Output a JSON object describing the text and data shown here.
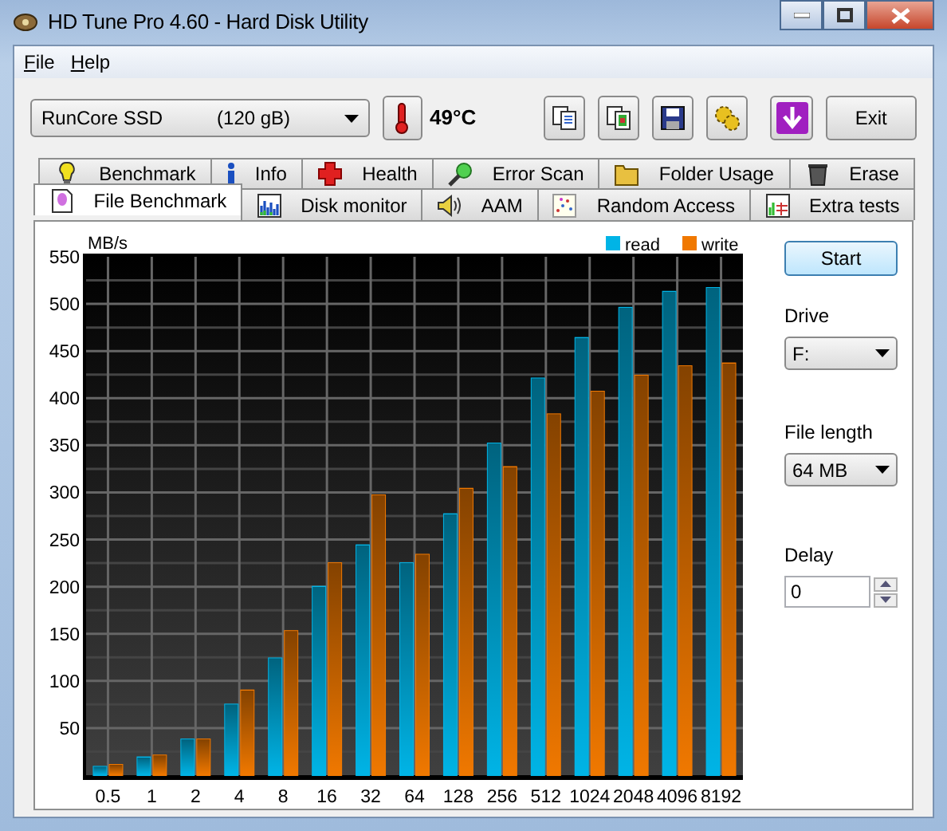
{
  "window": {
    "title": "HD Tune Pro 4.60 - Hard Disk Utility"
  },
  "menu": [
    "File",
    "Help"
  ],
  "toolbar": {
    "drive": {
      "name": "RunCore SSD",
      "size": "(120 gB)"
    },
    "temperature": "49°C",
    "icon_buttons": [
      {
        "kind": "copy"
      },
      {
        "kind": "copy-all"
      },
      {
        "kind": "save"
      },
      {
        "kind": "options"
      },
      {
        "kind": "download"
      }
    ],
    "exit": "Exit"
  },
  "tabs_row1": [
    {
      "label": "Benchmark",
      "kind": "bulb",
      "selected": false
    },
    {
      "label": "Info",
      "kind": "info",
      "selected": false
    },
    {
      "label": "Health",
      "kind": "cross",
      "selected": false
    },
    {
      "label": "Error Scan",
      "kind": "magnifier",
      "selected": false
    },
    {
      "label": "Folder Usage",
      "kind": "folder",
      "selected": false
    },
    {
      "label": "Erase",
      "kind": "trash",
      "selected": false
    }
  ],
  "tabs_row2": [
    {
      "label": "File Benchmark",
      "kind": "file",
      "selected": true
    },
    {
      "label": "Disk monitor",
      "kind": "bars",
      "selected": false
    },
    {
      "label": "AAM",
      "kind": "speaker",
      "selected": false
    },
    {
      "label": "Random Access",
      "kind": "dots",
      "selected": false
    },
    {
      "label": "Extra tests",
      "kind": "grid",
      "selected": false
    }
  ],
  "benchmark": {
    "chart_data": {
      "type": "bar",
      "ylabel": "MB/s",
      "categories": [
        "0.5",
        "1",
        "2",
        "4",
        "8",
        "16",
        "32",
        "64",
        "128",
        "256",
        "512",
        "1024",
        "2048",
        "4096",
        "8192"
      ],
      "series": [
        {
          "name": "read",
          "color": "#00b4e6",
          "values": [
            9,
            19,
            38,
            75,
            124,
            200,
            244,
            225,
            277,
            352,
            421,
            464,
            496,
            513,
            517
          ]
        },
        {
          "name": "write",
          "color": "#f07800",
          "values": [
            11,
            21,
            38,
            90,
            153,
            225,
            297,
            234,
            304,
            327,
            383,
            407,
            424,
            434,
            437
          ]
        }
      ],
      "ylim": [
        0,
        550
      ],
      "grid": true,
      "legend": true,
      "yticks": [
        50,
        100,
        150,
        200,
        250,
        300,
        350,
        400,
        450,
        500,
        550
      ]
    },
    "start": "Start",
    "drive_label": "Drive",
    "drive": "F:",
    "file_length_label": "File length",
    "file_length": "64 MB",
    "delay_label": "Delay",
    "delay": "0"
  }
}
